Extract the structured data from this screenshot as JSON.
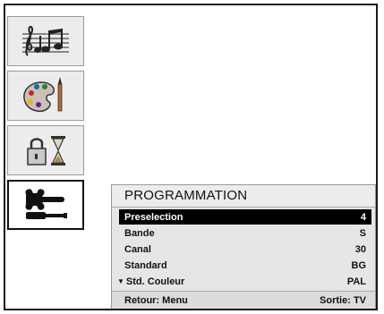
{
  "sidebar": {
    "items": [
      {
        "icon": "music-notes-icon"
      },
      {
        "icon": "palette-brush-icon"
      },
      {
        "icon": "lock-hourglass-icon"
      },
      {
        "icon": "wrench-screwdriver-icon",
        "active": true
      }
    ]
  },
  "menu": {
    "title": "PROGRAMMATION",
    "rows": [
      {
        "label": "Preselection",
        "value": "4",
        "selected": true
      },
      {
        "label": "Bande",
        "value": "S"
      },
      {
        "label": "Canal",
        "value": "30"
      },
      {
        "label": "Standard",
        "value": "BG"
      },
      {
        "label": "Std. Couleur",
        "value": "PAL",
        "arrow": "▼"
      }
    ],
    "footer_left": "Retour: Menu",
    "footer_right": "Sortie: TV"
  },
  "colors": {
    "selected_bg": "#000000",
    "panel_bg": "#e6e6e6",
    "frame": "#1a1a1a"
  }
}
